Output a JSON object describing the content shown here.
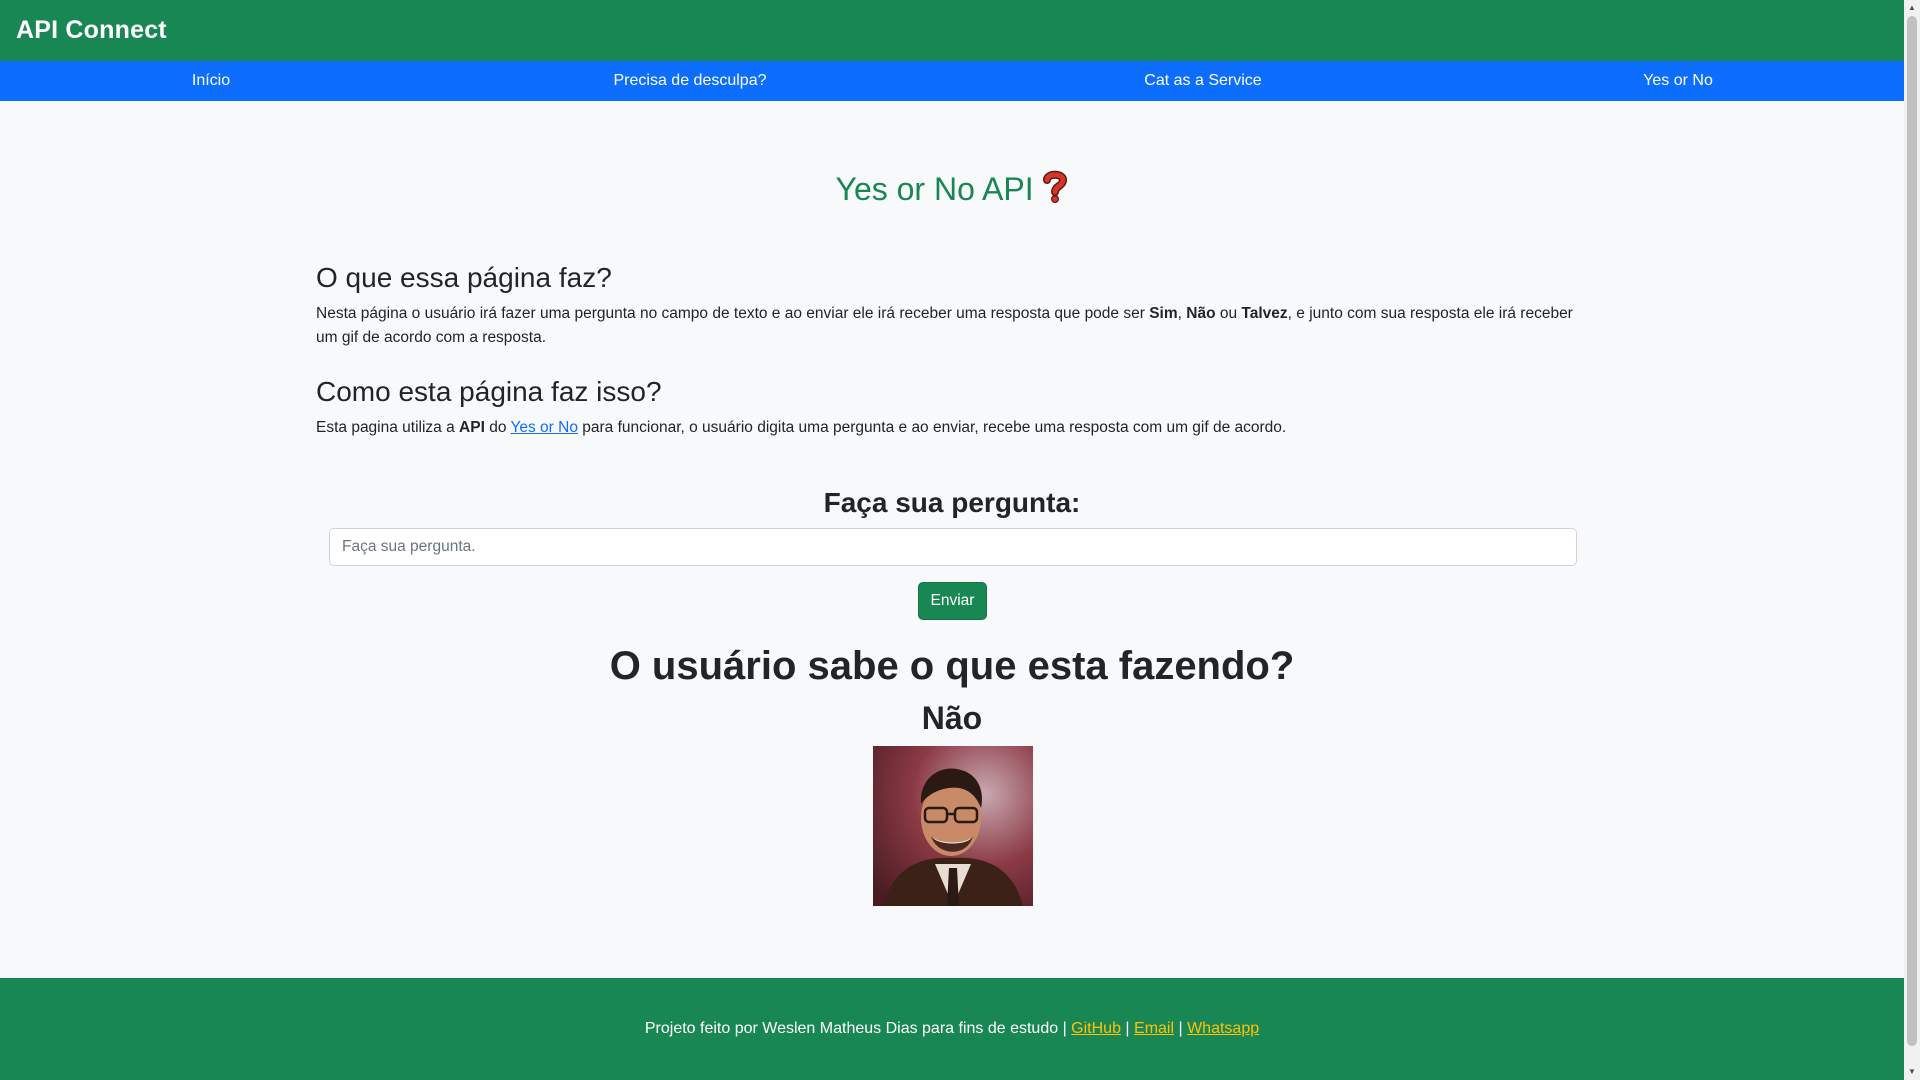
{
  "header": {
    "brand": "API Connect"
  },
  "nav": {
    "items": [
      {
        "label": "Início"
      },
      {
        "label": "Precisa de desculpa?"
      },
      {
        "label": "Cat as a Service"
      },
      {
        "label": "Yes or No"
      }
    ]
  },
  "main": {
    "title": "Yes or No API",
    "title_icon": "red-question-mark-icon",
    "section1": {
      "heading": "O que essa página faz?",
      "text_a": "Nesta página o usuário irá fazer uma pergunta no campo de texto e ao enviar ele irá receber uma resposta que pode ser ",
      "bold_sim": "Sim",
      "sep1": ", ",
      "bold_nao": "Não",
      "sep2": " ou ",
      "bold_talvez": "Talvez",
      "text_b": ", e junto com sua resposta ele irá receber um gif de acordo com a resposta."
    },
    "section2": {
      "heading": "Como esta página faz isso?",
      "text_a": "Esta pagina utiliza a ",
      "bold_api": "API",
      "text_b": " do ",
      "link": "Yes or No",
      "text_c": " para funcionar, o usuário digita uma pergunta e ao enviar, recebe uma resposta com um gif de acordo."
    },
    "form": {
      "title": "Faça sua pergunta:",
      "placeholder": "Faça sua pergunta.",
      "value": "",
      "submit_label": "Enviar"
    },
    "result": {
      "question": "O usuário sabe o que esta fazendo?",
      "answer": "Não"
    }
  },
  "footer": {
    "text": "Projeto feito por Weslen Matheus Dias para fins de estudo",
    "sep": " | ",
    "links": [
      "GitHub",
      "Email",
      "Whatsapp"
    ]
  },
  "colors": {
    "header_bg": "#198754",
    "nav_bg": "#0d6efd",
    "title_color": "#198754",
    "footer_link": "#ffc107"
  }
}
